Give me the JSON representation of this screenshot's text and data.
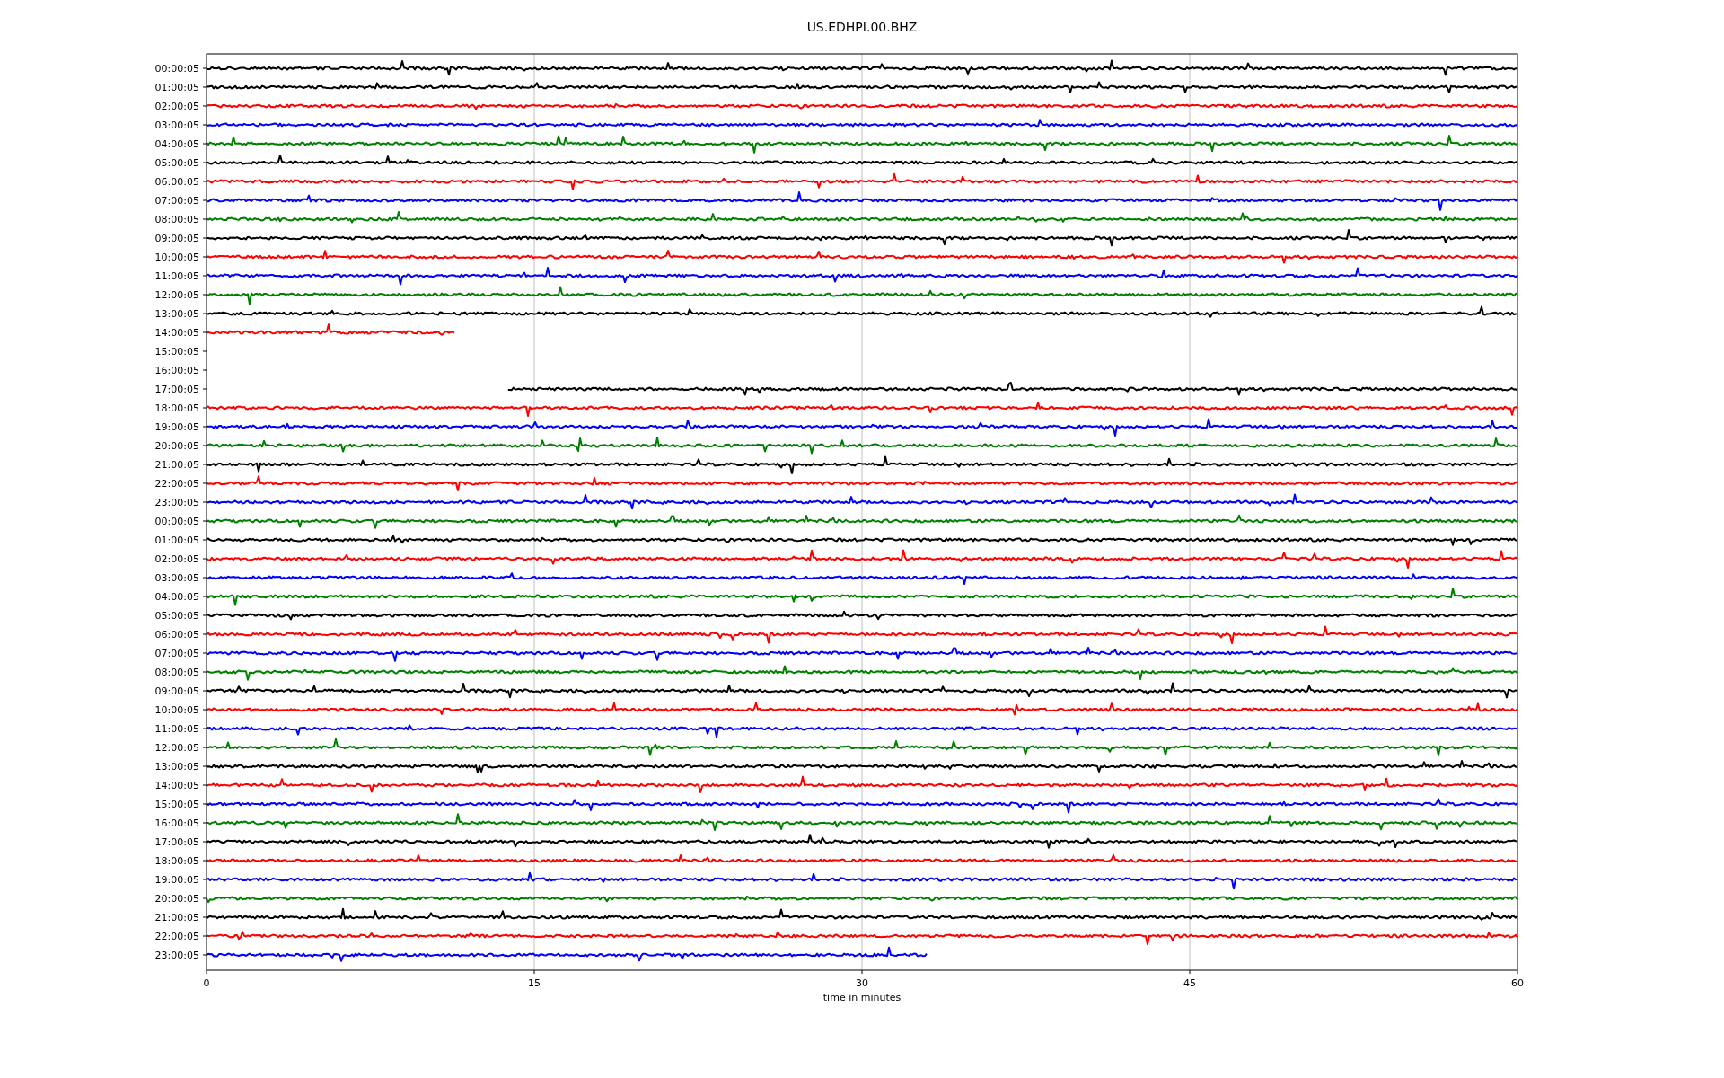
{
  "title": "US.EDHPI.00.BHZ",
  "x_axis": {
    "label": "time in minutes",
    "ticks": [
      "0",
      "15",
      "30",
      "45",
      "60"
    ]
  },
  "rows": [
    {
      "label": "00:00:05",
      "kind": "full",
      "color": "#000000"
    },
    {
      "label": "01:00:05",
      "kind": "full",
      "color": "#000000"
    },
    {
      "label": "02:00:05",
      "kind": "full",
      "color": "#ff0000"
    },
    {
      "label": "03:00:05",
      "kind": "full",
      "color": "#0000ff"
    },
    {
      "label": "04:00:05",
      "kind": "full",
      "color": "#008000"
    },
    {
      "label": "05:00:05",
      "kind": "full",
      "color": "#000000"
    },
    {
      "label": "06:00:05",
      "kind": "full",
      "color": "#ff0000"
    },
    {
      "label": "07:00:05",
      "kind": "full",
      "color": "#0000ff"
    },
    {
      "label": "08:00:05",
      "kind": "full",
      "color": "#008000"
    },
    {
      "label": "09:00:05",
      "kind": "full",
      "color": "#000000"
    },
    {
      "label": "10:00:05",
      "kind": "full",
      "color": "#ff0000"
    },
    {
      "label": "11:00:05",
      "kind": "full",
      "color": "#0000ff"
    },
    {
      "label": "12:00:05",
      "kind": "full",
      "color": "#008000"
    },
    {
      "label": "13:00:05",
      "kind": "full",
      "color": "#000000"
    },
    {
      "label": "14:00:05",
      "kind": "partial",
      "color": "#ff0000"
    },
    {
      "label": "15:00:05",
      "kind": "none"
    },
    {
      "label": "16:00:05",
      "kind": "none"
    },
    {
      "label": "17:00:05",
      "kind": "late",
      "color": "#000000"
    },
    {
      "label": "18:00:05",
      "kind": "full",
      "color": "#ff0000"
    },
    {
      "label": "19:00:05",
      "kind": "full",
      "color": "#0000ff"
    },
    {
      "label": "20:00:05",
      "kind": "full",
      "color": "#008000"
    },
    {
      "label": "21:00:05",
      "kind": "full",
      "color": "#000000"
    },
    {
      "label": "22:00:05",
      "kind": "full",
      "color": "#ff0000"
    },
    {
      "label": "23:00:05",
      "kind": "full",
      "color": "#0000ff"
    },
    {
      "label": "00:00:05",
      "kind": "full",
      "color": "#008000"
    },
    {
      "label": "01:00:05",
      "kind": "full",
      "color": "#000000"
    },
    {
      "label": "02:00:05",
      "kind": "full",
      "color": "#ff0000"
    },
    {
      "label": "03:00:05",
      "kind": "full",
      "color": "#0000ff"
    },
    {
      "label": "04:00:05",
      "kind": "full",
      "color": "#008000"
    },
    {
      "label": "05:00:05",
      "kind": "full",
      "color": "#000000"
    },
    {
      "label": "06:00:05",
      "kind": "full",
      "color": "#ff0000"
    },
    {
      "label": "07:00:05",
      "kind": "full",
      "color": "#0000ff"
    },
    {
      "label": "08:00:05",
      "kind": "full",
      "color": "#008000"
    },
    {
      "label": "09:00:05",
      "kind": "full",
      "color": "#000000"
    },
    {
      "label": "10:00:05",
      "kind": "full",
      "color": "#ff0000"
    },
    {
      "label": "11:00:05",
      "kind": "full",
      "color": "#0000ff"
    },
    {
      "label": "12:00:05",
      "kind": "full",
      "color": "#008000"
    },
    {
      "label": "13:00:05",
      "kind": "full",
      "color": "#000000"
    },
    {
      "label": "14:00:05",
      "kind": "full",
      "color": "#ff0000"
    },
    {
      "label": "15:00:05",
      "kind": "full",
      "color": "#0000ff"
    },
    {
      "label": "16:00:05",
      "kind": "full",
      "color": "#008000"
    },
    {
      "label": "17:00:05",
      "kind": "full",
      "color": "#000000"
    },
    {
      "label": "18:00:05",
      "kind": "full",
      "color": "#ff0000"
    },
    {
      "label": "19:00:05",
      "kind": "full",
      "color": "#0000ff"
    },
    {
      "label": "20:00:05",
      "kind": "full",
      "color": "#008000"
    },
    {
      "label": "21:00:05",
      "kind": "full",
      "color": "#000000"
    },
    {
      "label": "22:00:05",
      "kind": "full",
      "color": "#ff0000"
    },
    {
      "label": "23:00:05",
      "kind": "partial",
      "color": "#0000ff"
    }
  ]
}
